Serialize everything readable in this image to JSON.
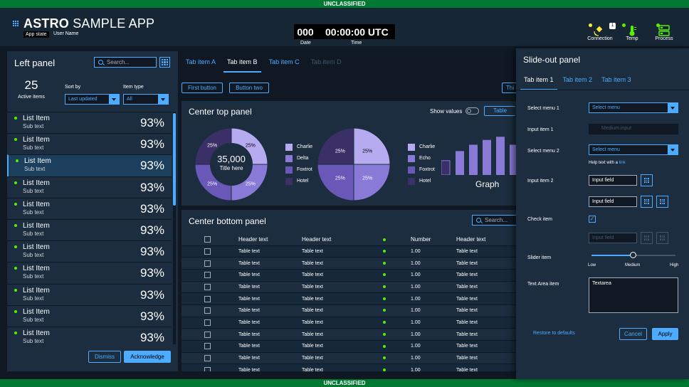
{
  "classification": "UNCLASSIFIED",
  "header": {
    "title_bold": "ASTRO",
    "title_rest": " SAMPLE APP",
    "app_state": "App state",
    "user_name": "User Name",
    "clock": {
      "day": "000",
      "time": "00:00:00 UTC",
      "day_label": "Date",
      "time_label": "Time"
    },
    "monitors": [
      {
        "label": "Connection",
        "badge": "1",
        "icon": "satellite-icon",
        "status_color": "#fce83a"
      },
      {
        "label": "Temp",
        "icon": "thermometer-icon",
        "status_color": "#56f000"
      },
      {
        "label": "Process",
        "icon": "process-icon",
        "status_color": "#56f000"
      }
    ]
  },
  "left_panel": {
    "title": "Left panel",
    "search_placeholder": "Search...",
    "count": "25",
    "count_label": "Active items",
    "sort_label": "Sort by",
    "sort_value": "Last updated",
    "type_label": "Item type",
    "type_value": "All",
    "items": [
      {
        "title": "List Item",
        "sub": "Sub text",
        "pct": "93%"
      },
      {
        "title": "List Item",
        "sub": "Sub text",
        "pct": "93%"
      },
      {
        "title": "List Item",
        "sub": "Sub text",
        "pct": "93%"
      },
      {
        "title": "List Item",
        "sub": "Sub text",
        "pct": "93%"
      },
      {
        "title": "List Item",
        "sub": "Sub text",
        "pct": "93%"
      },
      {
        "title": "List Item",
        "sub": "Sub text",
        "pct": "93%"
      },
      {
        "title": "List Item",
        "sub": "Sub text",
        "pct": "93%"
      },
      {
        "title": "List Item",
        "sub": "Sub text",
        "pct": "93%"
      },
      {
        "title": "List Item",
        "sub": "Sub text",
        "pct": "93%"
      },
      {
        "title": "List Item",
        "sub": "Sub text",
        "pct": "93%"
      },
      {
        "title": "List Item",
        "sub": "Sub text",
        "pct": "93%"
      }
    ],
    "dismiss": "Dismiss",
    "acknowledge": "Acknowledge"
  },
  "center": {
    "tabs": [
      "Tab item A",
      "Tab item B",
      "Tab item C",
      "Tab item D"
    ],
    "first_button": "First button",
    "button_two": "Button two",
    "third_button": "Thi",
    "top": {
      "title": "Center top panel",
      "show_values": "Show values",
      "table_btn": "Table",
      "donut_value": "35,000",
      "donut_label": "Title here",
      "graph_label": "Graph"
    },
    "bottom": {
      "title": "Center bottom panel",
      "search_placeholder": "Search...",
      "headers": [
        "Header text",
        "Header text",
        "Number",
        "Header text"
      ],
      "rows": [
        [
          "Table text",
          "Table text",
          "1.00",
          "Table text"
        ],
        [
          "Table text",
          "Table text",
          "1.00",
          "Table text"
        ],
        [
          "Table text",
          "Table text",
          "1.00",
          "Table text"
        ],
        [
          "Table text",
          "Table text",
          "1.00",
          "Table text"
        ],
        [
          "Table text",
          "Table text",
          "1.00",
          "Table text"
        ],
        [
          "Table text",
          "Table text",
          "1.00",
          "Table text"
        ],
        [
          "Table text",
          "Table text",
          "1.00",
          "Table text"
        ],
        [
          "Table text",
          "Table text",
          "1.00",
          "Table text"
        ],
        [
          "Table text",
          "Table text",
          "1.00",
          "Table text"
        ],
        [
          "Table text",
          "Table text",
          "1.00",
          "Table text"
        ],
        [
          "Table text",
          "Table text",
          "1.00",
          "Table text"
        ]
      ]
    }
  },
  "chart_data": [
    {
      "type": "pie",
      "variant": "donut",
      "slices": [
        {
          "name": "Charlie",
          "value": 25
        },
        {
          "name": "Delta",
          "value": 25
        },
        {
          "name": "Foxtrot",
          "value": 25
        },
        {
          "name": "Hotel",
          "value": 25
        }
      ],
      "center_value": "35,000",
      "center_label": "Title here",
      "colors": [
        "#b6aaf0",
        "#8a7ad8",
        "#6a58b8",
        "#3a2f66"
      ]
    },
    {
      "type": "pie",
      "slices": [
        {
          "name": "Charlie",
          "value": 25
        },
        {
          "name": "Echo",
          "value": 25
        },
        {
          "name": "Foxtrot",
          "value": 25
        },
        {
          "name": "Hotel",
          "value": 25
        }
      ],
      "colors": [
        "#b6aaf0",
        "#8a7ad8",
        "#6a58b8",
        "#3a2f66"
      ]
    },
    {
      "type": "bar",
      "title": "Graph",
      "values": [
        18,
        30,
        38,
        44,
        48,
        38
      ]
    }
  ],
  "slideout": {
    "title": "Slide-out panel",
    "tabs": [
      "Tab item 1",
      "Tab item 2",
      "Tab item 3"
    ],
    "select1_label": "Select menu 1",
    "select1_value": "Select menu",
    "input1_label": "Input item 1",
    "input1_placeholder": "Medium input",
    "select2_label": "Select menu 2",
    "select2_value": "Select menu",
    "help_text": "Help text with a ",
    "help_link": "link",
    "input2_label": "Input item 2",
    "input2a": "Input field",
    "input2b": "Input field",
    "check_label": "Check item",
    "check_mark": "✓",
    "input3": "Input field",
    "slider_label": "Slider item",
    "slider_level": 0.5,
    "slider_low": "Low",
    "slider_mid": "Medium",
    "slider_high": "High",
    "textarea_label": "Text Area item",
    "textarea_value": "Textarea",
    "restore": "Restore to defaults",
    "cancel": "Cancel",
    "apply": "Apply"
  }
}
